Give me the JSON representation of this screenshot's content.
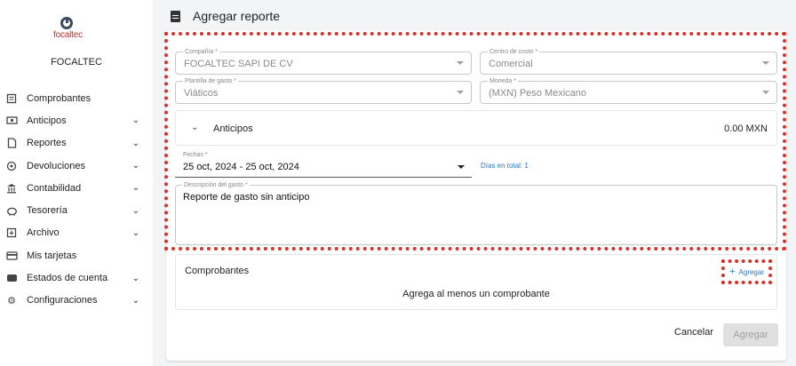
{
  "brand": {
    "logo_text": "focaltec",
    "company": "FOCALTEC"
  },
  "sidebar": {
    "items": [
      {
        "label": "Comprobantes",
        "icon": "receipt-icon",
        "expandable": false
      },
      {
        "label": "Anticipos",
        "icon": "money-icon",
        "expandable": true
      },
      {
        "label": "Reportes",
        "icon": "document-icon",
        "expandable": true
      },
      {
        "label": "Devoluciones",
        "icon": "return-icon",
        "expandable": true
      },
      {
        "label": "Contabilidad",
        "icon": "bank-icon",
        "expandable": true
      },
      {
        "label": "Tesorería",
        "icon": "piggy-bank-icon",
        "expandable": true
      },
      {
        "label": "Archivo",
        "icon": "archive-icon",
        "expandable": true
      },
      {
        "label": "Mis tarjetas",
        "icon": "card-icon",
        "expandable": false
      },
      {
        "label": "Estados de cuenta",
        "icon": "statement-icon",
        "expandable": true
      },
      {
        "label": "Configuraciones",
        "icon": "gear-icon",
        "expandable": true
      }
    ]
  },
  "header": {
    "title": "Agregar reporte"
  },
  "form": {
    "compania": {
      "label": "Compañía *",
      "value": "FOCALTEC SAPI DE CV"
    },
    "centro": {
      "label": "Centro de costo *",
      "value": "Comercial"
    },
    "plantilla": {
      "label": "Plantilla de gasto *",
      "value": "Viáticos"
    },
    "moneda": {
      "label": "Moneda *",
      "value": "(MXN) Peso Mexicano"
    },
    "anticipos": {
      "label": "Anticipos",
      "amount": "0.00 MXN"
    },
    "fechas": {
      "label": "Fechas *",
      "value": "25 oct, 2024 - 25 oct, 2024"
    },
    "dias": "Días en total: 1",
    "descripcion": {
      "label": "Descripción del gasto *",
      "value": "Reporte de gasto sin anticipo"
    }
  },
  "comprobantes": {
    "title": "Comprobantes",
    "add_label": "Agregar",
    "empty": "Agrega al menos un comprobante"
  },
  "actions": {
    "cancel": "Cancelar",
    "submit": "Agregar"
  },
  "colors": {
    "link": "#2a78c8",
    "highlight": "#d9302a",
    "disabled_bg": "#e0e0e0"
  }
}
